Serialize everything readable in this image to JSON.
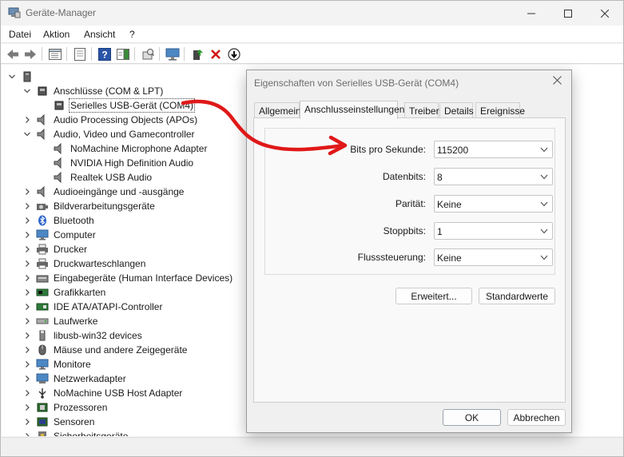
{
  "window": {
    "title": "Geräte-Manager"
  },
  "menu": [
    "Datei",
    "Aktion",
    "Ansicht",
    "?"
  ],
  "tree": {
    "root_label": "",
    "nodes": [
      {
        "label": "Anschlüsse (COM & LPT)",
        "icon": "port-icon",
        "expanded": true
      },
      {
        "label": "Serielles USB-Gerät (COM4)",
        "icon": "port-device-icon",
        "child": true
      },
      {
        "label": "Audio Processing Objects (APOs)",
        "icon": "speaker-icon"
      },
      {
        "label": "Audio, Video und Gamecontroller",
        "icon": "speaker-icon",
        "expanded": true
      },
      {
        "label": "NoMachine Microphone Adapter",
        "icon": "speaker-device-icon",
        "child": true
      },
      {
        "label": "NVIDIA High Definition Audio",
        "icon": "speaker-device-icon",
        "child": true
      },
      {
        "label": "Realtek USB Audio",
        "icon": "speaker-device-icon",
        "child": true
      },
      {
        "label": "Audioeingänge und -ausgänge",
        "icon": "speaker-icon"
      },
      {
        "label": "Bildverarbeitungsgeräte",
        "icon": "camera-icon"
      },
      {
        "label": "Bluetooth",
        "icon": "bluetooth-icon"
      },
      {
        "label": "Computer",
        "icon": "monitor-icon"
      },
      {
        "label": "Drucker",
        "icon": "printer-icon"
      },
      {
        "label": "Druckwarteschlangen",
        "icon": "printer-icon"
      },
      {
        "label": "Eingabegeräte (Human Interface Devices)",
        "icon": "hid-icon"
      },
      {
        "label": "Grafikkarten",
        "icon": "display-adapter-icon"
      },
      {
        "label": "IDE ATA/ATAPI-Controller",
        "icon": "ide-controller-icon"
      },
      {
        "label": "Laufwerke",
        "icon": "disk-drive-icon"
      },
      {
        "label": "libusb-win32 devices",
        "icon": "usb-stick-icon"
      },
      {
        "label": "Mäuse und andere Zeigegeräte",
        "icon": "mouse-icon"
      },
      {
        "label": "Monitore",
        "icon": "monitor-icon"
      },
      {
        "label": "Netzwerkadapter",
        "icon": "network-icon"
      },
      {
        "label": "NoMachine USB Host Adapter",
        "icon": "usb-icon"
      },
      {
        "label": "Prozessoren",
        "icon": "cpu-icon"
      },
      {
        "label": "Sensoren",
        "icon": "sensor-icon"
      },
      {
        "label": "Sicherheitsgeräte",
        "icon": "security-icon"
      }
    ]
  },
  "dialog": {
    "title": "Eigenschaften von Serielles USB-Gerät (COM4)",
    "tabs": [
      "Allgemein",
      "Anschlusseinstellungen",
      "Treiber",
      "Details",
      "Ereignisse"
    ],
    "active_tab": "Anschlusseinstellungen",
    "fields": [
      {
        "label": "Bits pro Sekunde:",
        "value": "115200"
      },
      {
        "label": "Datenbits:",
        "value": "8"
      },
      {
        "label": "Parität:",
        "value": "Keine"
      },
      {
        "label": "Stoppbits:",
        "value": "1"
      },
      {
        "label": "Flusssteuerung:",
        "value": "Keine"
      }
    ],
    "buttons": {
      "advanced": "Erweitert...",
      "defaults": "Standardwerte",
      "ok": "OK",
      "cancel": "Abbrechen"
    }
  },
  "colors": {
    "annotation": "#e01818",
    "accent": "#0067c0"
  }
}
